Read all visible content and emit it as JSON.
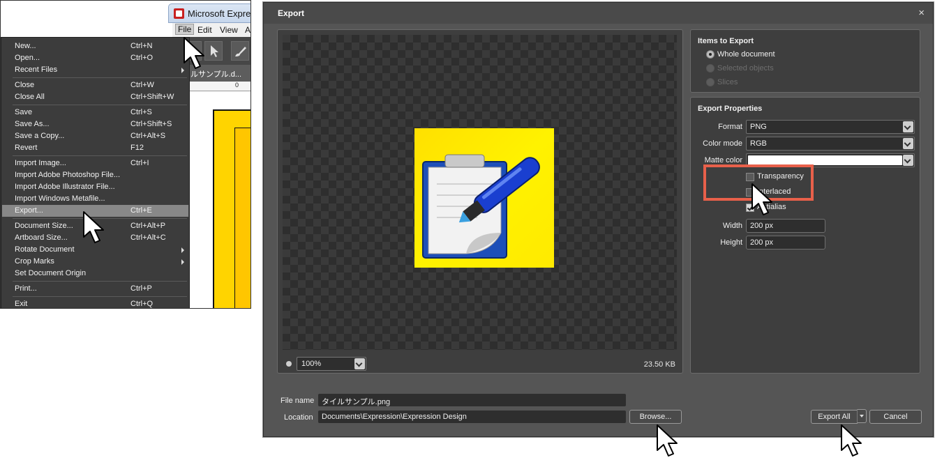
{
  "app": {
    "title": "Microsoft Expre",
    "menubar": [
      "File",
      "Edit",
      "View",
      "A"
    ],
    "tab_title": "ルサンプル.d...",
    "ruler_label": "0"
  },
  "file_menu": {
    "items": [
      {
        "label": "New...",
        "shortcut": "Ctrl+N"
      },
      {
        "label": "Open...",
        "shortcut": "Ctrl+O"
      },
      {
        "label": "Recent Files",
        "shortcut": "",
        "submenu": true
      },
      {
        "label": "Close",
        "shortcut": "Ctrl+W"
      },
      {
        "label": "Close All",
        "shortcut": "Ctrl+Shift+W"
      },
      {
        "label": "Save",
        "shortcut": "Ctrl+S"
      },
      {
        "label": "Save As...",
        "shortcut": "Ctrl+Shift+S"
      },
      {
        "label": "Save a Copy...",
        "shortcut": "Ctrl+Alt+S"
      },
      {
        "label": "Revert",
        "shortcut": "F12"
      },
      {
        "label": "Import Image...",
        "shortcut": "Ctrl+I"
      },
      {
        "label": "Import Adobe Photoshop File...",
        "shortcut": ""
      },
      {
        "label": "Import Adobe Illustrator File...",
        "shortcut": ""
      },
      {
        "label": "Import Windows Metafile...",
        "shortcut": ""
      },
      {
        "label": "Export...",
        "shortcut": "Ctrl+E",
        "highlighted": true
      },
      {
        "label": "Document Size...",
        "shortcut": "Ctrl+Alt+P"
      },
      {
        "label": "Artboard Size...",
        "shortcut": "Ctrl+Alt+C"
      },
      {
        "label": "Rotate Document",
        "shortcut": "",
        "submenu": true
      },
      {
        "label": "Crop Marks",
        "shortcut": "",
        "submenu": true
      },
      {
        "label": "Set Document Origin",
        "shortcut": ""
      },
      {
        "label": "Print...",
        "shortcut": "Ctrl+P"
      },
      {
        "label": "Exit",
        "shortcut": "Ctrl+Q"
      }
    ]
  },
  "dialog": {
    "title": "Export",
    "close_glyph": "×",
    "preview": {
      "zoom": "100%",
      "file_size": "23.50 KB"
    },
    "items_to_export": {
      "heading": "Items to Export",
      "options": [
        {
          "label": "Whole document",
          "checked": true,
          "enabled": true
        },
        {
          "label": "Selected objects",
          "checked": false,
          "enabled": false
        },
        {
          "label": "Slices",
          "checked": false,
          "enabled": false
        }
      ]
    },
    "export_properties": {
      "heading": "Export Properties",
      "format_label": "Format",
      "format_value": "PNG",
      "color_mode_label": "Color mode",
      "color_mode_value": "RGB",
      "matte_color_label": "Matte color",
      "matte_color_value": "#ffffff",
      "transparency_label": "Transparency",
      "transparency_checked": false,
      "interlaced_label": "Interlaced",
      "interlaced_checked": false,
      "antialias_label": "Antialias",
      "antialias_checked": true,
      "width_label": "Width",
      "width_value": "200 px",
      "height_label": "Height",
      "height_value": "200 px"
    },
    "file_name_label": "File name",
    "file_name_value": "タイルサンプル.png",
    "location_label": "Location",
    "location_value": "Documents\\Expression\\Expression Design",
    "browse_label": "Browse...",
    "export_all_label": "Export All",
    "cancel_label": "Cancel"
  },
  "colors": {
    "dialog_bg": "#555555",
    "panel_bg": "#3e3e3e",
    "highlight_box": "#e8604a",
    "preview_yellow": "#ffe800",
    "menu_highlight": "#888888"
  }
}
